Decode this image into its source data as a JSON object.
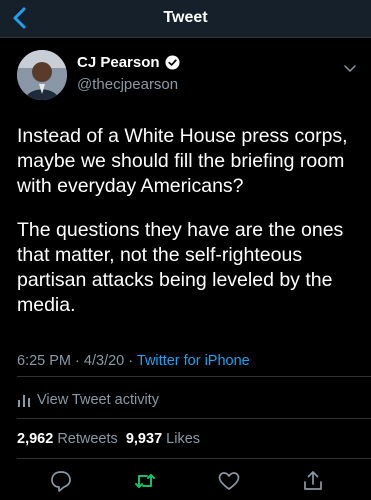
{
  "header": {
    "title": "Tweet"
  },
  "tweet": {
    "author_name": "CJ Pearson",
    "handle": "@thecjpearson",
    "paragraphs": [
      "Instead of a White House press corps, maybe we should fill the briefing room with everyday Americans?",
      "The questions they have are the ones that matter, not the self-righteous partisan attacks being leveled by the media."
    ],
    "time": "6:25 PM",
    "date": "4/3/20",
    "dot": "·",
    "source": "Twitter for iPhone"
  },
  "activity": {
    "label": "View Tweet activity"
  },
  "stats": {
    "retweets_count": "2,962",
    "retweets_label": "Retweets",
    "likes_count": "9,937",
    "likes_label": "Likes"
  },
  "actions": {
    "icons": [
      "reply-icon",
      "retweet-icon",
      "like-icon",
      "share-icon"
    ]
  },
  "colors": {
    "accent": "#1da1f2",
    "retweet_green": "#17bf63",
    "secondary_text": "#8b98a5",
    "header_bg": "#15202b"
  }
}
